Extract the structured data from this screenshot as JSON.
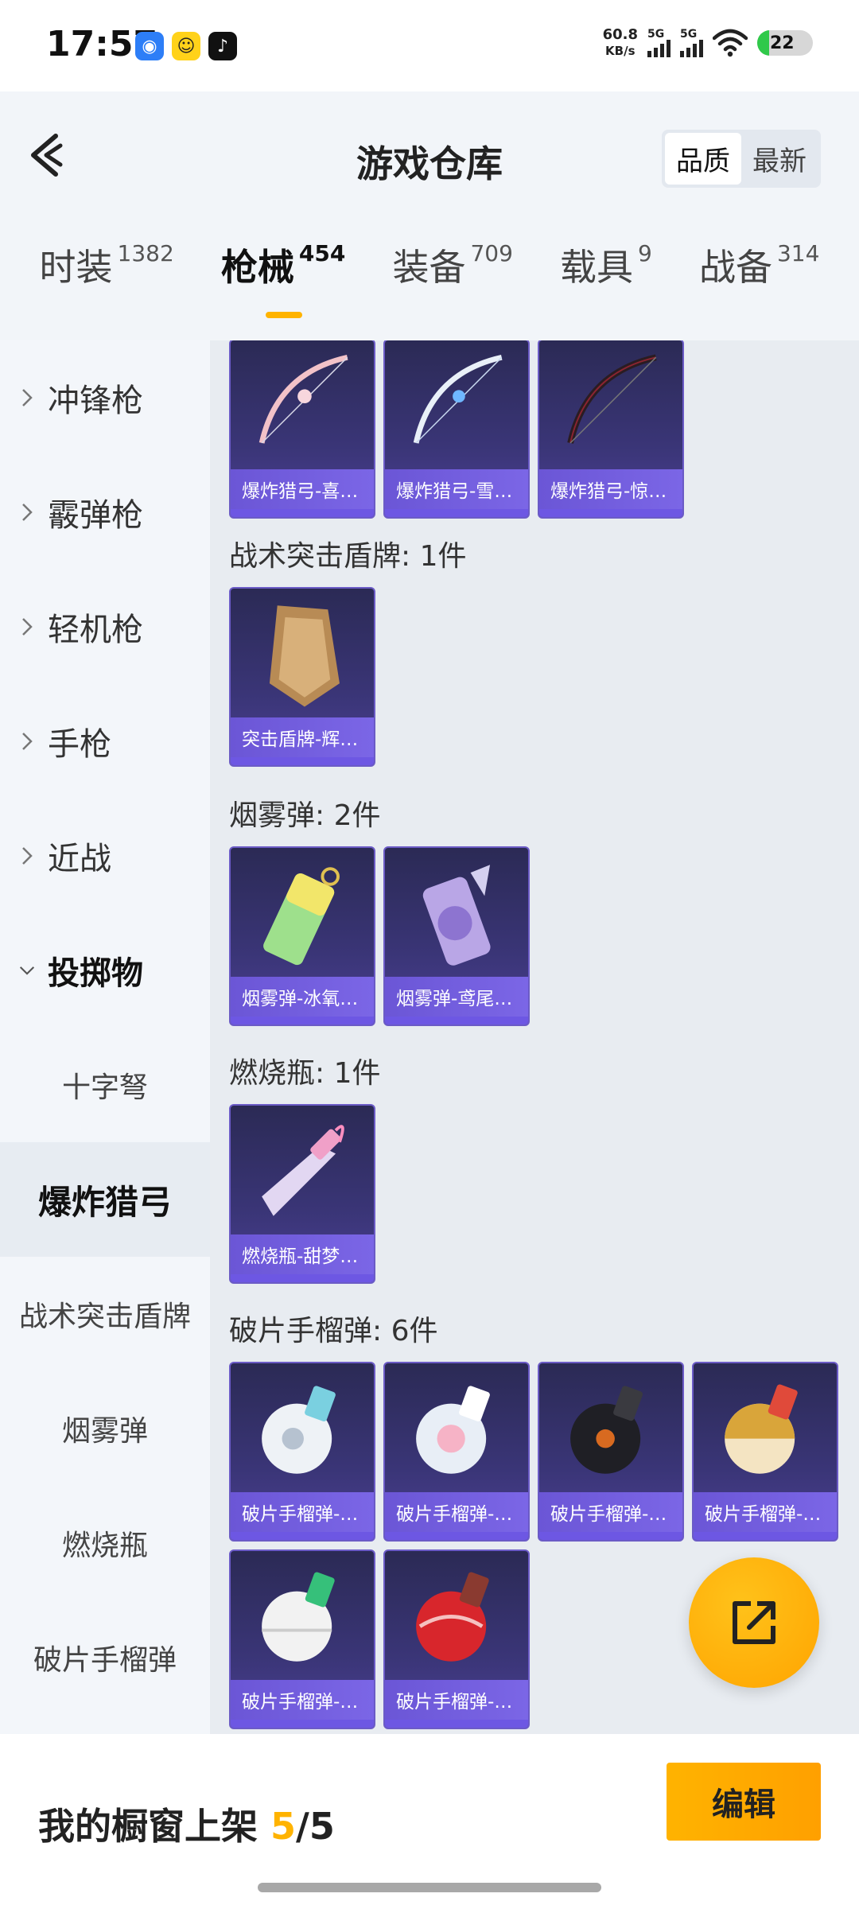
{
  "status_bar": {
    "time": "17:57",
    "net_speed_value": "60.8",
    "net_speed_unit": "KB/s",
    "signal1_label": "5G",
    "signal2_label": "5G",
    "battery": "22",
    "app_icons": [
      "app-icon-blue",
      "app-icon-yellow",
      "tiktok-icon"
    ]
  },
  "header": {
    "title": "游戏仓库",
    "sort_options": [
      {
        "label": "品质",
        "selected": true
      },
      {
        "label": "最新",
        "selected": false
      }
    ]
  },
  "tabs": [
    {
      "name": "时装",
      "count": "1382",
      "active": false
    },
    {
      "name": "枪械",
      "count": "454",
      "active": true
    },
    {
      "name": "装备",
      "count": "709",
      "active": false
    },
    {
      "name": "载具",
      "count": "9",
      "active": false
    },
    {
      "name": "战备",
      "count": "314",
      "active": false
    }
  ],
  "sidebar": {
    "groups": [
      {
        "label": "冲锋枪",
        "expanded": false
      },
      {
        "label": "霰弹枪",
        "expanded": false
      },
      {
        "label": "轻机枪",
        "expanded": false
      },
      {
        "label": "手枪",
        "expanded": false
      },
      {
        "label": "近战",
        "expanded": false
      },
      {
        "label": "投掷物",
        "expanded": true
      }
    ],
    "subitems": [
      {
        "label": "十字弩",
        "selected": false
      },
      {
        "label": "爆炸猎弓",
        "selected": true
      },
      {
        "label": "战术突击盾牌",
        "selected": false
      },
      {
        "label": "烟雾弹",
        "selected": false
      },
      {
        "label": "燃烧瓶",
        "selected": false
      },
      {
        "label": "破片手榴弹",
        "selected": false
      }
    ]
  },
  "sections": [
    {
      "title": "",
      "items": [
        "爆炸猎弓-喜…",
        "爆炸猎弓-雪…",
        "爆炸猎弓-惊…"
      ]
    },
    {
      "title": "战术突击盾牌: 1件",
      "items": [
        "突击盾牌-辉…"
      ]
    },
    {
      "title": "烟雾弹: 2件",
      "items": [
        "烟雾弹-冰氧…",
        "烟雾弹-鸢尾…"
      ]
    },
    {
      "title": "燃烧瓶: 1件",
      "items": [
        "燃烧瓶-甜梦…"
      ]
    },
    {
      "title": "破片手榴弹: 6件",
      "items": [
        "破片手榴弹-…",
        "破片手榴弹-…",
        "破片手榴弹-…",
        "破片手榴弹-…",
        "破片手榴弹-…",
        "破片手榴弹-…"
      ]
    }
  ],
  "bottom": {
    "label_prefix": "我的橱窗上架 ",
    "count_current": "5",
    "count_sep": "/",
    "count_total": "5",
    "edit_button": "编辑"
  },
  "colors": {
    "accent": "#ffb300",
    "card_bg": "#3a3577",
    "card_caption": "#6b56d6"
  }
}
